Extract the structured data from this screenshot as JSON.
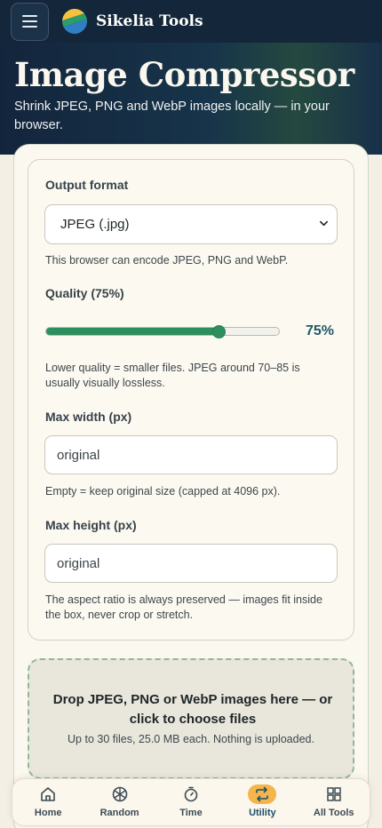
{
  "header": {
    "brand": "Sikelia Tools",
    "title": "Image Compressor",
    "subtitle": "Shrink JPEG, PNG and WebP images locally — in your browser."
  },
  "settings": {
    "output_format": {
      "label": "Output format",
      "selected": "JPEG (.jpg)",
      "hint": "This browser can encode JPEG, PNG and WebP."
    },
    "quality": {
      "label": "Quality (75%)",
      "value": 75,
      "display": "75%",
      "hint": "Lower quality = smaller files. JPEG around 70–85 is usually visually lossless."
    },
    "max_width": {
      "label": "Max width (px)",
      "placeholder": "original",
      "hint": "Empty = keep original size (capped at 4096 px)."
    },
    "max_height": {
      "label": "Max height (px)",
      "placeholder": "original",
      "hint": "The aspect ratio is always preserved — images fit inside the box, never crop or stretch."
    }
  },
  "dropzone": {
    "title": "Drop JPEG, PNG or WebP images here — or click to choose files",
    "subtitle": "Up to 30 files, 25.0 MB each. Nothing is uploaded."
  },
  "bottom_nav": {
    "items": [
      {
        "label": "Home",
        "icon": "home-icon"
      },
      {
        "label": "Random",
        "icon": "random-icon"
      },
      {
        "label": "Time",
        "icon": "timer-icon"
      },
      {
        "label": "Utility",
        "icon": "swap-icon",
        "active": true
      },
      {
        "label": "All Tools",
        "icon": "grid-icon"
      }
    ]
  },
  "colors": {
    "accent_green": "#2e8f5e",
    "nav_active": "#f5b54a",
    "header_bg": "#14263a"
  }
}
